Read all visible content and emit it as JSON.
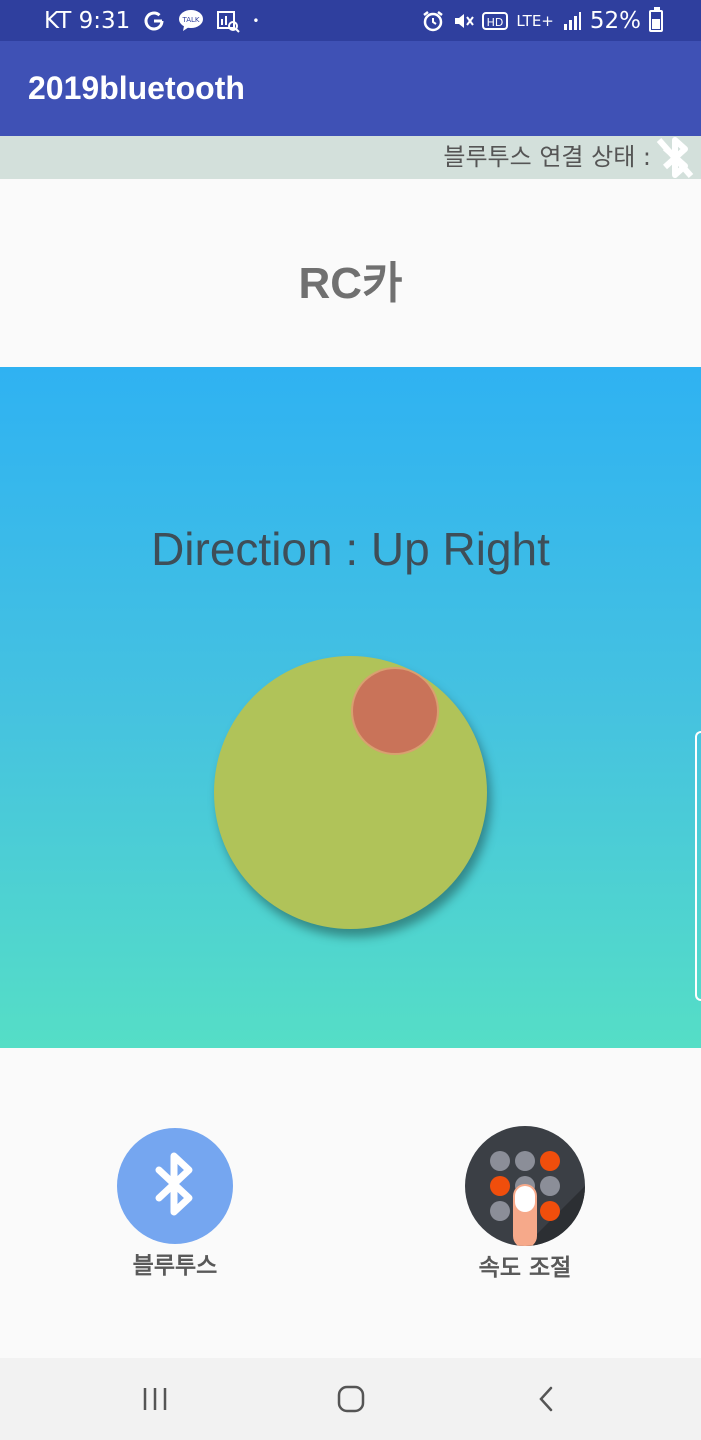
{
  "status_bar": {
    "carrier_time": "KT 9:31",
    "dot": "•",
    "network": "LTE+",
    "battery": "52%",
    "battery_level": 0.52,
    "icons": [
      "google-icon",
      "kakaotalk-icon",
      "stats-icon",
      "alarm-icon",
      "mute-icon",
      "hd-icon",
      "lte-icon",
      "signal-icon",
      "battery-icon"
    ]
  },
  "app_bar": {
    "title": "2019bluetooth"
  },
  "connection": {
    "label": "블루투스 연결 상태 :",
    "icon": "bluetooth-disabled-icon"
  },
  "page": {
    "title": "RC카"
  },
  "joystick": {
    "direction_text": "Direction : Up Right"
  },
  "actions": {
    "bluetooth_label": "블루투스",
    "speed_label": "속도 조절",
    "bluetooth_icon": "bluetooth-icon",
    "speed_icon": "keypad-touch-icon"
  },
  "colors": {
    "status_bar": "#2f3f9e",
    "app_bar": "#3f51b5",
    "connection_bar": "#d3e0db",
    "joystick_gradient_top": "#2fb2f2",
    "joystick_gradient_bottom": "#55dec6",
    "joystick_base": "#b0c359",
    "joystick_knob": "#c97359",
    "bluetooth_button": "#75a6f0"
  },
  "nav_bar": {
    "icons": [
      "recents-icon",
      "home-icon",
      "back-icon"
    ]
  }
}
